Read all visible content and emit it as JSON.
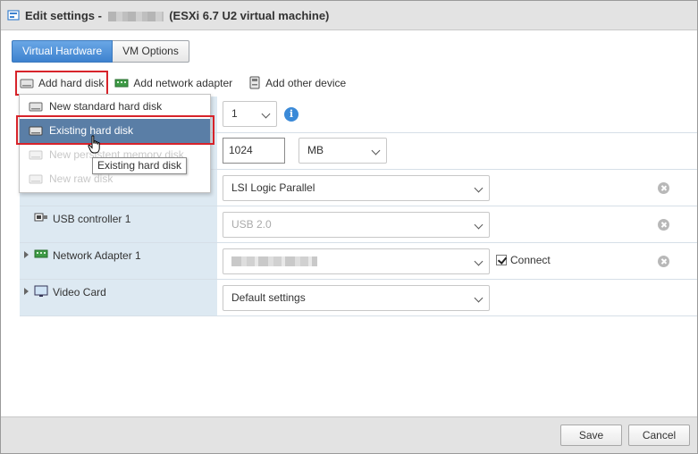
{
  "title": {
    "prefix": "Edit settings -",
    "suffix": "(ESXi 6.7 U2 virtual machine)"
  },
  "tabs": [
    {
      "label": "Virtual Hardware",
      "active": true
    },
    {
      "label": "VM Options",
      "active": false
    }
  ],
  "toolbar": {
    "add_hard_disk": "Add hard disk",
    "add_network_adapter": "Add network adapter",
    "add_other_device": "Add other device"
  },
  "menu": {
    "items": [
      {
        "label": "New standard hard disk",
        "state": "normal"
      },
      {
        "label": "Existing hard disk",
        "state": "selected"
      },
      {
        "label": "New persistent memory disk",
        "state": "disabled"
      },
      {
        "label": "New raw disk",
        "state": "disabled"
      }
    ],
    "tooltip": "Existing hard disk"
  },
  "rows": {
    "cpu": {
      "value": "1"
    },
    "memory": {
      "value": "1024",
      "unit": "MB"
    },
    "scsi": {
      "value": "LSI Logic Parallel"
    },
    "usb": {
      "label": "USB controller 1",
      "value": "USB 2.0"
    },
    "network": {
      "label": "Network Adapter 1",
      "connect_label": "Connect",
      "connected": true
    },
    "video": {
      "label": "Video Card",
      "value": "Default settings"
    }
  },
  "footer": {
    "save": "Save",
    "cancel": "Cancel"
  },
  "colors": {
    "accent_blue": "#3d82cf",
    "label_column_bg": "#dde9f2",
    "highlight_red": "#d7232a",
    "menu_selected": "#5a7ea6"
  }
}
